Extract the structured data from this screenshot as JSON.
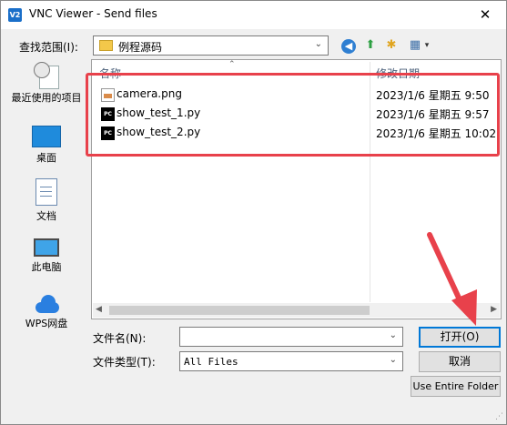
{
  "window": {
    "title": "VNC Viewer - Send files",
    "app_icon_text": "V2",
    "close_glyph": "✕"
  },
  "lookin": {
    "label": "查找范围(I):",
    "value": "例程源码",
    "dropdown_glyph": "⌄"
  },
  "toolbar": {
    "back_glyph": "◀",
    "up_glyph": "⬆",
    "newfolder_glyph": "✱",
    "view_glyph": "▦",
    "view_dd_glyph": "▾"
  },
  "places": [
    {
      "label": "最近使用的项目",
      "icon": "recent-icon"
    },
    {
      "label": "桌面",
      "icon": "desktop-icon"
    },
    {
      "label": "文档",
      "icon": "documents-icon"
    },
    {
      "label": "此电脑",
      "icon": "this-pc-icon"
    },
    {
      "label": "WPS网盘",
      "icon": "wps-cloud-icon"
    }
  ],
  "file_list": {
    "columns": {
      "name": "名称",
      "date": "修改日期"
    },
    "sort_glyph": "⌃",
    "rows": [
      {
        "name": "camera.png",
        "date": "2023/1/6 星期五 9:50",
        "icon": "png-file-icon"
      },
      {
        "name": "show_test_1.py",
        "date": "2023/1/6 星期五 9:57",
        "icon": "pycharm-file-icon",
        "icon_text": "PC"
      },
      {
        "name": "show_test_2.py",
        "date": "2023/1/6 星期五 10:02",
        "icon": "pycharm-file-icon",
        "icon_text": "PC"
      }
    ],
    "scroll_left": "◀",
    "scroll_right": "▶"
  },
  "form": {
    "filename_label": "文件名(N):",
    "filename_value": "",
    "filetype_label": "文件类型(T):",
    "filetype_value": "All Files",
    "dropdown_glyph": "⌄"
  },
  "buttons": {
    "open": "打开(O)",
    "cancel": "取消",
    "entire_folder": "Use Entire Folder"
  },
  "annotation": {
    "highlight_color": "#e8414b"
  },
  "grip_glyph": "⋰"
}
